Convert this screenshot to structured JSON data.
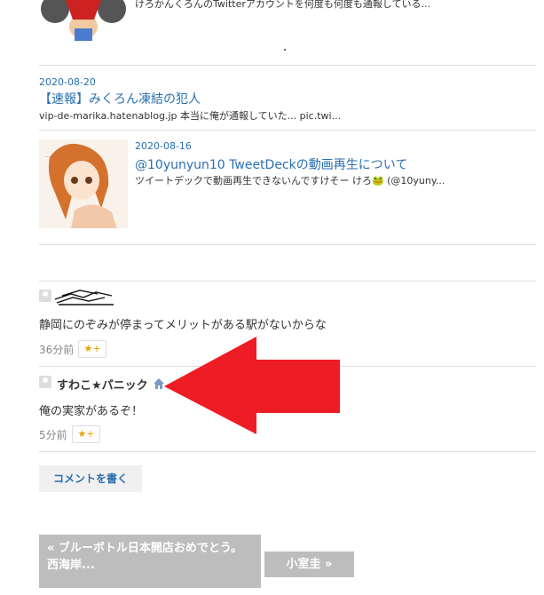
{
  "top_entry": {
    "snippet": "けろかんくろんのTwitterアカウントを何度も何度も通報している..."
  },
  "entries": [
    {
      "date": "2020-08-20",
      "title": "【速報】みくろん凍結の犯人",
      "snippet": "vip-de-marika.hatenablog.jp 本当に俺が通報していた... pic.twi..."
    },
    {
      "date": "2020-08-16",
      "title": "@10yunyun10 TweetDeckの動画再生について",
      "snippet": "ツイートデックで動画再生できないんですけそー けろ🐸 (@10yuny..."
    }
  ],
  "comments": [
    {
      "text": "静岡にのぞみが停まってメリットがある駅がないからな",
      "time": "36分前",
      "star_label": "★+"
    },
    {
      "author": "すわこ★パニック",
      "text": "俺の実家があるぞ！",
      "time": "5分前",
      "star_label": "★+"
    }
  ],
  "comment_button": "コメントを書く",
  "pager": {
    "prev": "« ブルーボトル日本開店おめでとう。西海岸...",
    "next": "小室圭 »"
  },
  "colors": {
    "link": "#2a6fb0",
    "arrow": "#ee1c25",
    "pager_bg": "#bdbdbd"
  }
}
